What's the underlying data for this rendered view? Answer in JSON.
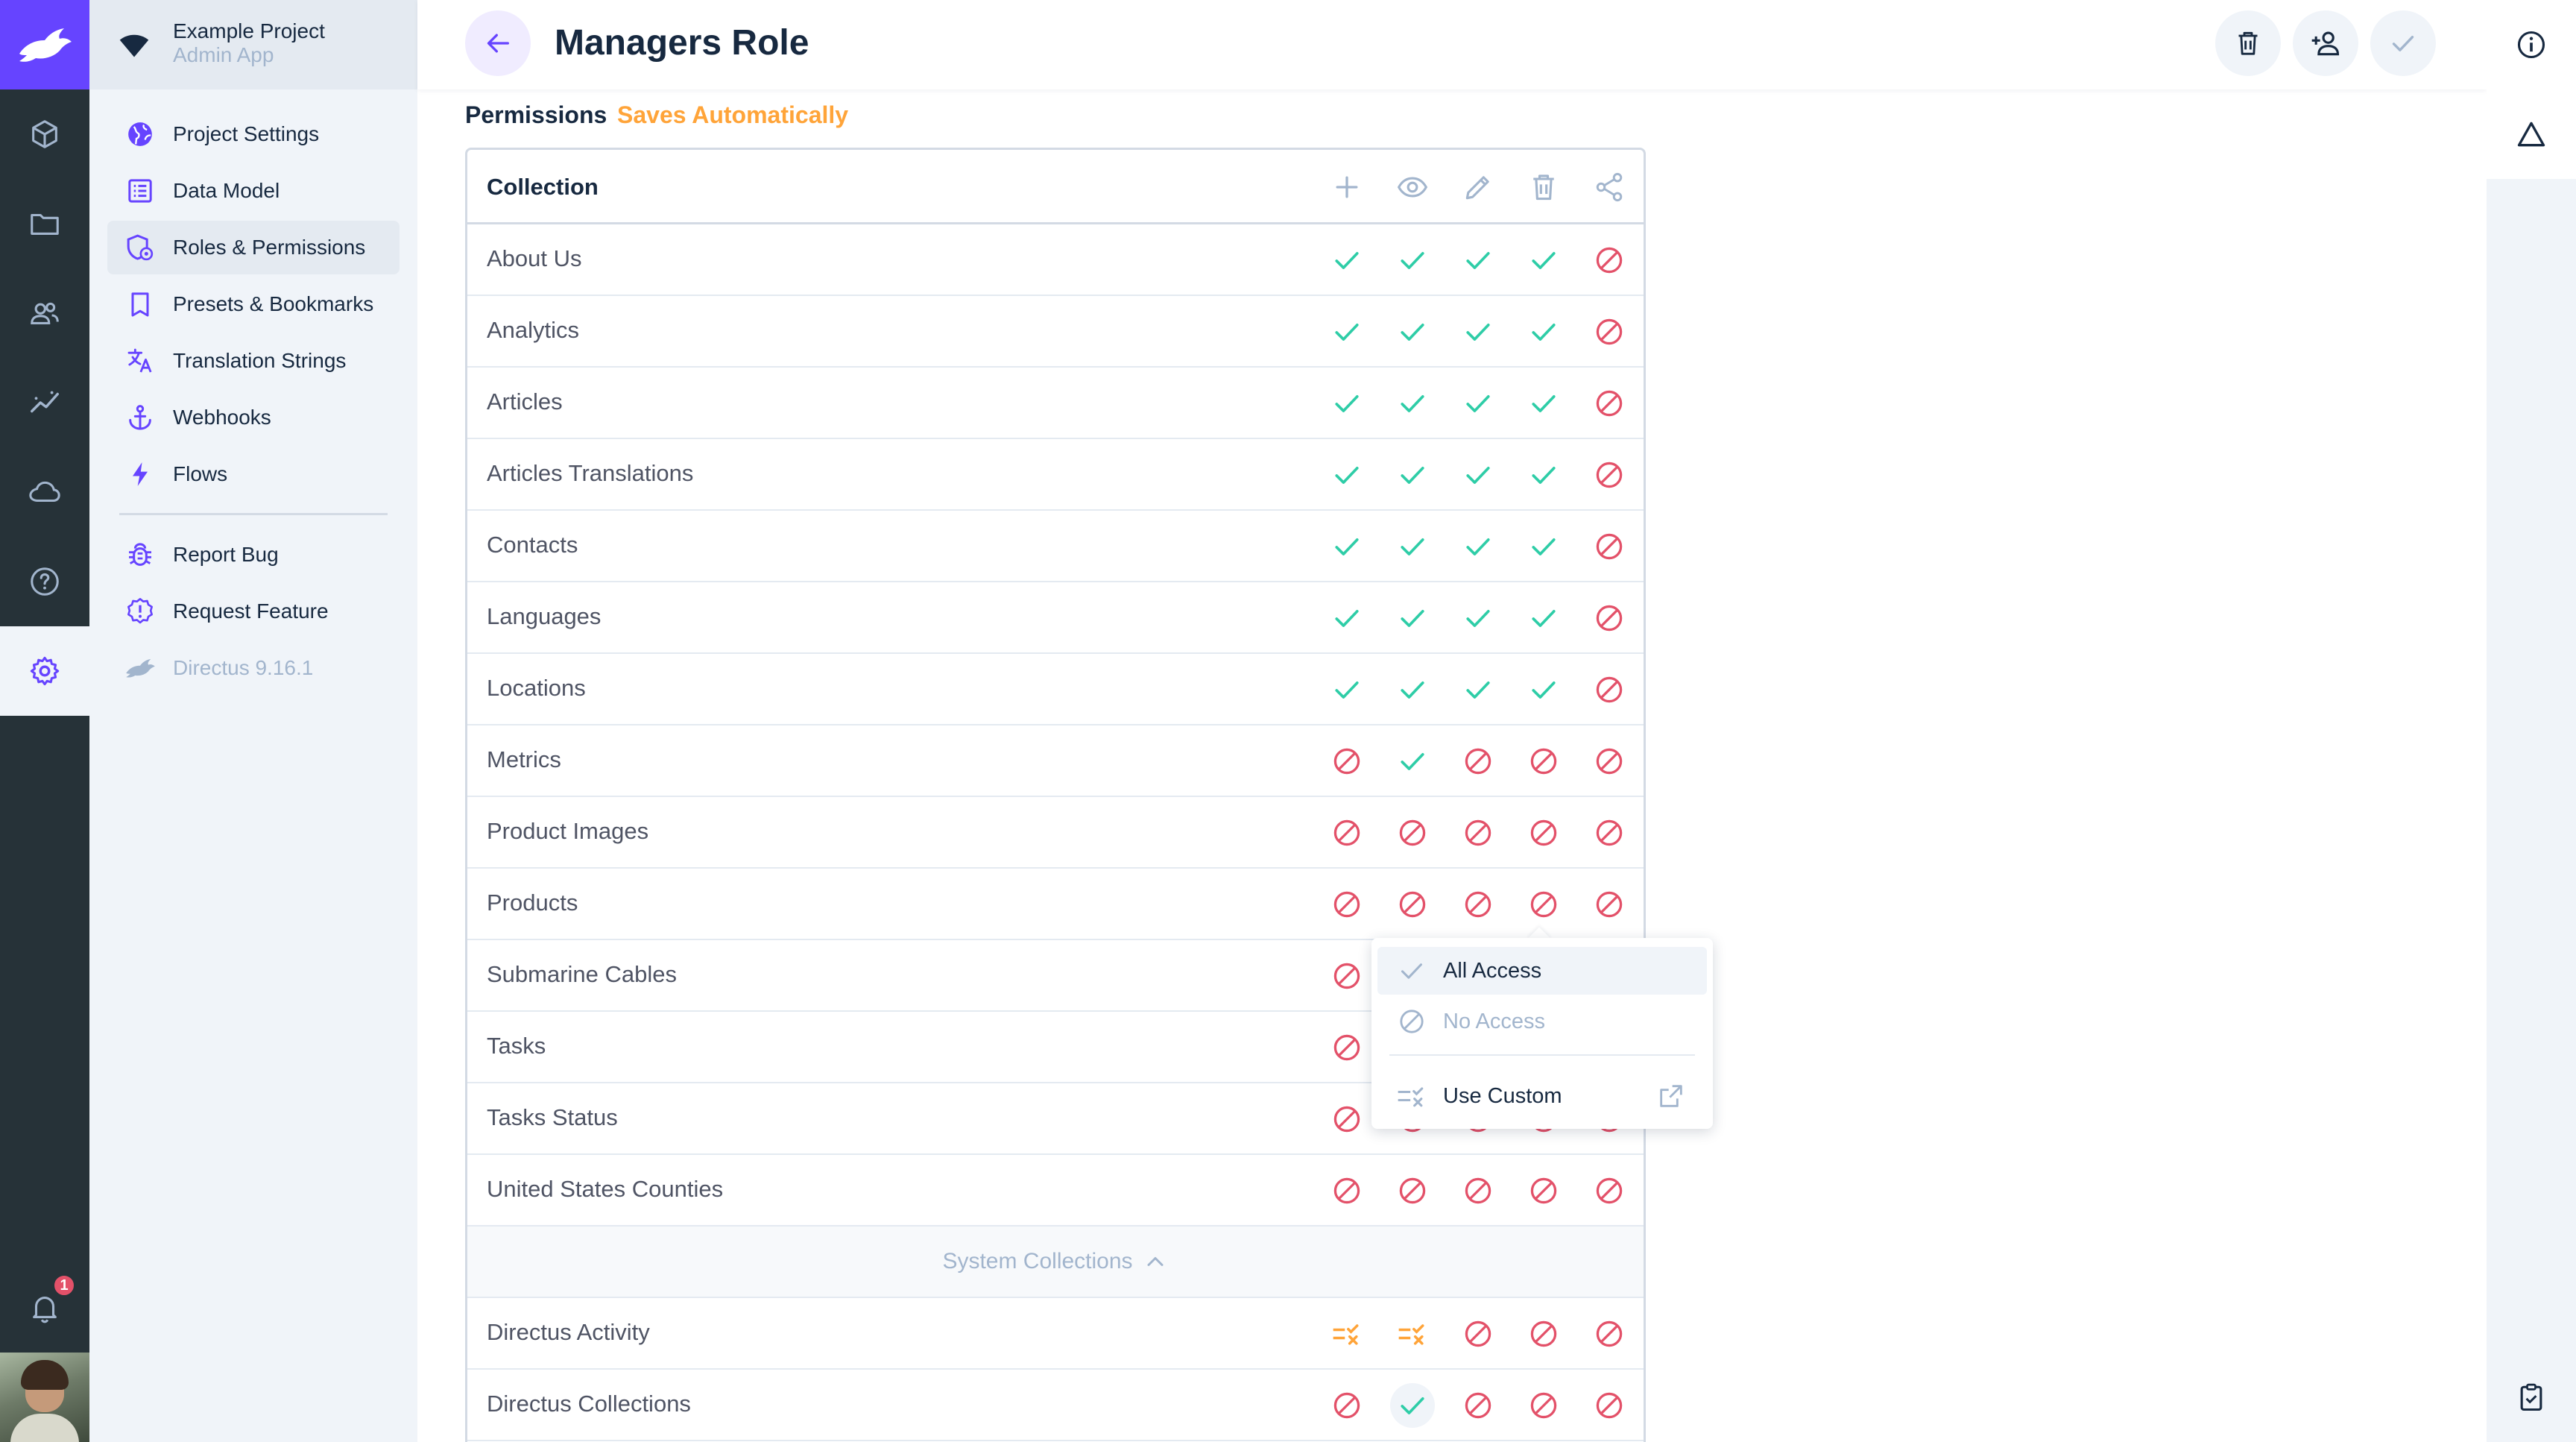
{
  "app": {
    "project_name": "Example Project",
    "project_sub": "Admin App",
    "notification_count": "1"
  },
  "nav": {
    "items": [
      {
        "label": "Project Settings",
        "icon": "public-icon"
      },
      {
        "label": "Data Model",
        "icon": "list-alt-icon"
      },
      {
        "label": "Roles & Permissions",
        "icon": "admin-panel-settings-icon",
        "active": true
      },
      {
        "label": "Presets & Bookmarks",
        "icon": "bookmark-icon"
      },
      {
        "label": "Translation Strings",
        "icon": "translate-icon"
      },
      {
        "label": "Webhooks",
        "icon": "anchor-icon"
      },
      {
        "label": "Flows",
        "icon": "bolt-icon"
      }
    ],
    "footer_items": [
      {
        "label": "Report Bug",
        "icon": "bug-report-icon"
      },
      {
        "label": "Request Feature",
        "icon": "new-releases-icon"
      },
      {
        "label": "Directus 9.16.1",
        "icon": "directus-logo-icon"
      }
    ]
  },
  "header": {
    "title": "Managers Role"
  },
  "permissions": {
    "label": "Permissions",
    "auto_label": "Saves Automatically",
    "column_header": "Collection",
    "action_icons": [
      "add-icon",
      "visibility-icon",
      "edit-icon",
      "delete-icon",
      "share-icon"
    ],
    "rows": [
      {
        "name": "About Us",
        "perms": [
          "all",
          "all",
          "all",
          "all",
          "none"
        ]
      },
      {
        "name": "Analytics",
        "perms": [
          "all",
          "all",
          "all",
          "all",
          "none"
        ]
      },
      {
        "name": "Articles",
        "perms": [
          "all",
          "all",
          "all",
          "all",
          "none"
        ]
      },
      {
        "name": "Articles Translations",
        "perms": [
          "all",
          "all",
          "all",
          "all",
          "none"
        ]
      },
      {
        "name": "Contacts",
        "perms": [
          "all",
          "all",
          "all",
          "all",
          "none"
        ]
      },
      {
        "name": "Languages",
        "perms": [
          "all",
          "all",
          "all",
          "all",
          "none"
        ]
      },
      {
        "name": "Locations",
        "perms": [
          "all",
          "all",
          "all",
          "all",
          "none"
        ]
      },
      {
        "name": "Metrics",
        "perms": [
          "none",
          "all",
          "none",
          "none",
          "none"
        ]
      },
      {
        "name": "Product Images",
        "perms": [
          "none",
          "none",
          "none",
          "none",
          "none"
        ]
      },
      {
        "name": "Products",
        "perms": [
          "none",
          "none",
          "none",
          "none",
          "none"
        ]
      },
      {
        "name": "Submarine Cables",
        "perms": [
          "none",
          "none",
          "none",
          "none",
          "none"
        ]
      },
      {
        "name": "Tasks",
        "perms": [
          "none",
          "none",
          "none",
          "none",
          "none"
        ]
      },
      {
        "name": "Tasks Status",
        "perms": [
          "none",
          "none",
          "none",
          "none",
          "none"
        ]
      },
      {
        "name": "United States Counties",
        "perms": [
          "none",
          "none",
          "none",
          "none",
          "none"
        ]
      }
    ],
    "system_label": "System Collections",
    "system_rows": [
      {
        "name": "Directus Activity",
        "perms": [
          "custom",
          "custom",
          "none",
          "none",
          "none"
        ]
      },
      {
        "name": "Directus Collections",
        "perms": [
          "none",
          "all",
          "none",
          "none",
          "none"
        ]
      }
    ]
  },
  "menu": {
    "all_access": "All Access",
    "no_access": "No Access",
    "use_custom": "Use Custom"
  },
  "colors": {
    "accent": "#6644ff",
    "success": "#2ecda7",
    "danger": "#e35169",
    "warning": "#ffa439"
  }
}
